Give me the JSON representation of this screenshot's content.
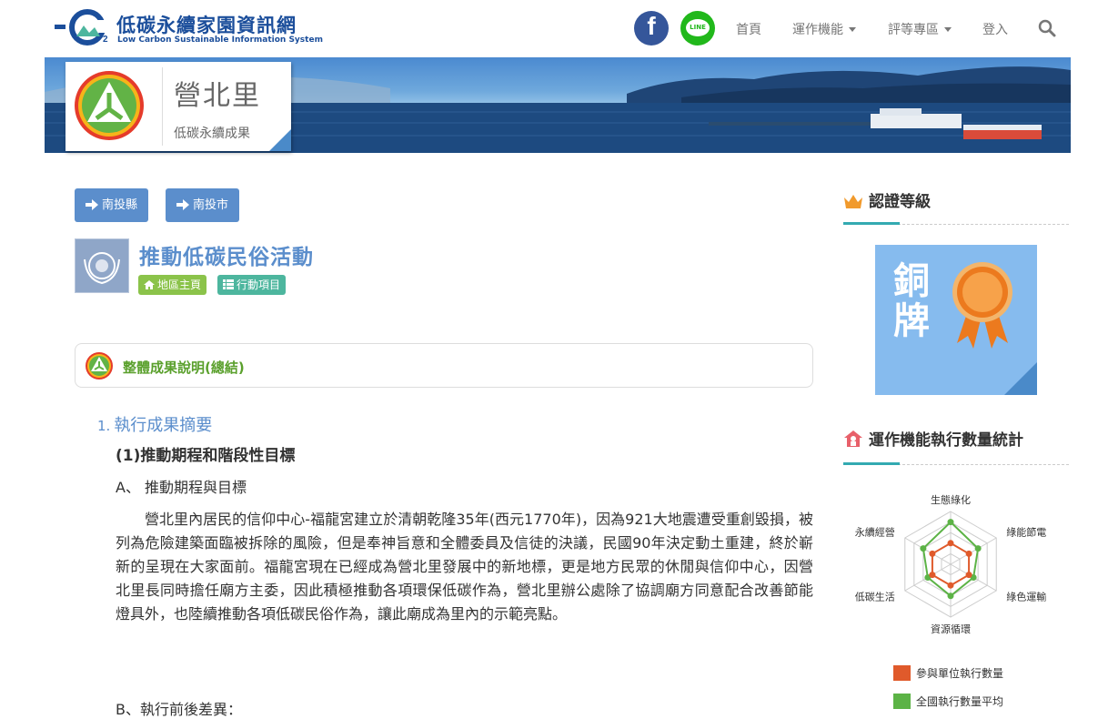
{
  "header": {
    "logo_title": "低碳永續家園資訊網",
    "logo_subtitle": "Low Carbon Sustainable Information System",
    "facebook_glyph": "f",
    "line_label": "LINE",
    "nav": {
      "home": "首頁",
      "features": "運作機能",
      "rating": "評等專區",
      "login": "登入"
    }
  },
  "banner": {
    "village_name": "營北里",
    "subtitle": "低碳永續成果"
  },
  "breadcrumb": {
    "county_button": "南投縣",
    "city_button": "南投市"
  },
  "page": {
    "title": "推動低碳民俗活動",
    "tag_home": "地區主頁",
    "tag_actions": "行動項目",
    "summary_label": "整體成果說明(總結)",
    "section_number": "1.",
    "section_title": "執行成果摘要",
    "subsection_title": "(1)推動期程和階段性目標",
    "item_a": "A、 推動期程與目標",
    "paragraph": "營北里內居民的信仰中心-福龍宮建立於清朝乾隆35年(西元1770年)，因為921大地震遭受重創毀損，被列為危險建築面臨被拆除的風險，但是奉神旨意和全體委員及信徒的決議，民國90年決定動土重建，終於嶄新的呈現在大家面前。福龍宮現在已經成為營北里發展中的新地標，更是地方民眾的休閒與信仰中心，因營北里長同時擔任廟方主委，因此積極推動各項環保低碳作為，營北里辦公處除了協調廟方同意配合改善節能燈具外，也陸續推動各項低碳民俗作為，讓此廟成為里內的示範亮點。",
    "item_b": "B、執行前後差異："
  },
  "sidebar": {
    "cert_heading": "認證等級",
    "medal_text": "銅牌",
    "stats_heading": "運作機能執行數量統計",
    "legend_participant": "參與單位執行數量",
    "legend_national": "全國執行數量平均"
  },
  "chart_data": {
    "type": "radar",
    "categories": [
      "生態綠化",
      "綠能節電",
      "綠色運輸",
      "資源循環",
      "低碳生活",
      "永續經營"
    ],
    "series": [
      {
        "name": "參與單位執行數量",
        "values": [
          2,
          2,
          2,
          2,
          2,
          2
        ]
      },
      {
        "name": "全國執行數量平均",
        "values": [
          4,
          3,
          2.5,
          3,
          2.5,
          3
        ]
      }
    ],
    "range": [
      0,
      5
    ],
    "colors": {
      "participant": "#e05a2b",
      "national": "#5cb346"
    }
  },
  "colors": {
    "brand_blue": "#1b4e9b",
    "button_blue": "#5b8ecc",
    "green_text": "#5aa02c",
    "accent_teal": "#33aab1",
    "medal_bg": "#86bbee"
  }
}
